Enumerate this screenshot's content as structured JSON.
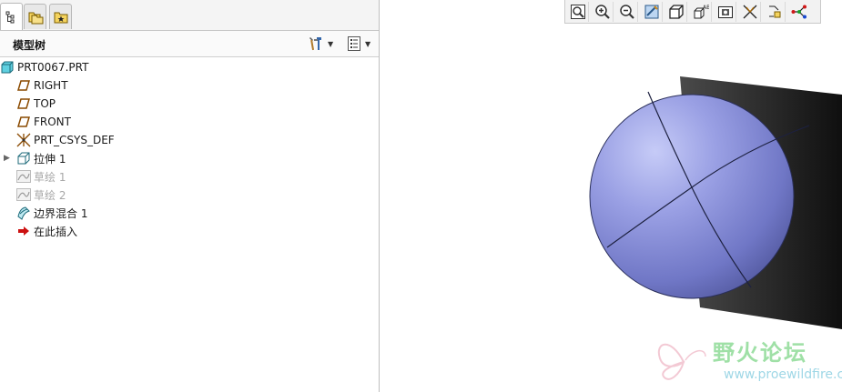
{
  "panel": {
    "tree_title": "模型树"
  },
  "tree": {
    "items": [
      {
        "label": "PRT0067.PRT",
        "icon": "part-icon"
      },
      {
        "label": "RIGHT",
        "icon": "datum-plane-icon"
      },
      {
        "label": "TOP",
        "icon": "datum-plane-icon"
      },
      {
        "label": "FRONT",
        "icon": "datum-plane-icon"
      },
      {
        "label": "PRT_CSYS_DEF",
        "icon": "csys-icon"
      },
      {
        "label": "拉伸 1",
        "icon": "extrude-icon",
        "expandable": true
      },
      {
        "label": "草绘 1",
        "icon": "sketch-icon",
        "dimmed": true
      },
      {
        "label": "草绘 2",
        "icon": "sketch-icon",
        "dimmed": true
      },
      {
        "label": "边界混合 1",
        "icon": "boundary-blend-icon"
      },
      {
        "label": "在此插入",
        "icon": "insert-here-arrow-icon"
      }
    ]
  },
  "toolbar": {
    "icons": [
      "refit-icon",
      "zoom-in-icon",
      "zoom-out-icon",
      "repaint-icon",
      "display-style-icon",
      "saved-views-icon",
      "view-manager-icon",
      "datum-display-icon",
      "annotation-display-icon",
      "spin-center-icon"
    ]
  },
  "colors": {
    "sphere": "#8d93da",
    "cylinder": "#2c2c2c",
    "insert_arrow": "#cc1111"
  },
  "watermark": {
    "title": "野火论坛",
    "url": "www.proewildfire.cn"
  }
}
